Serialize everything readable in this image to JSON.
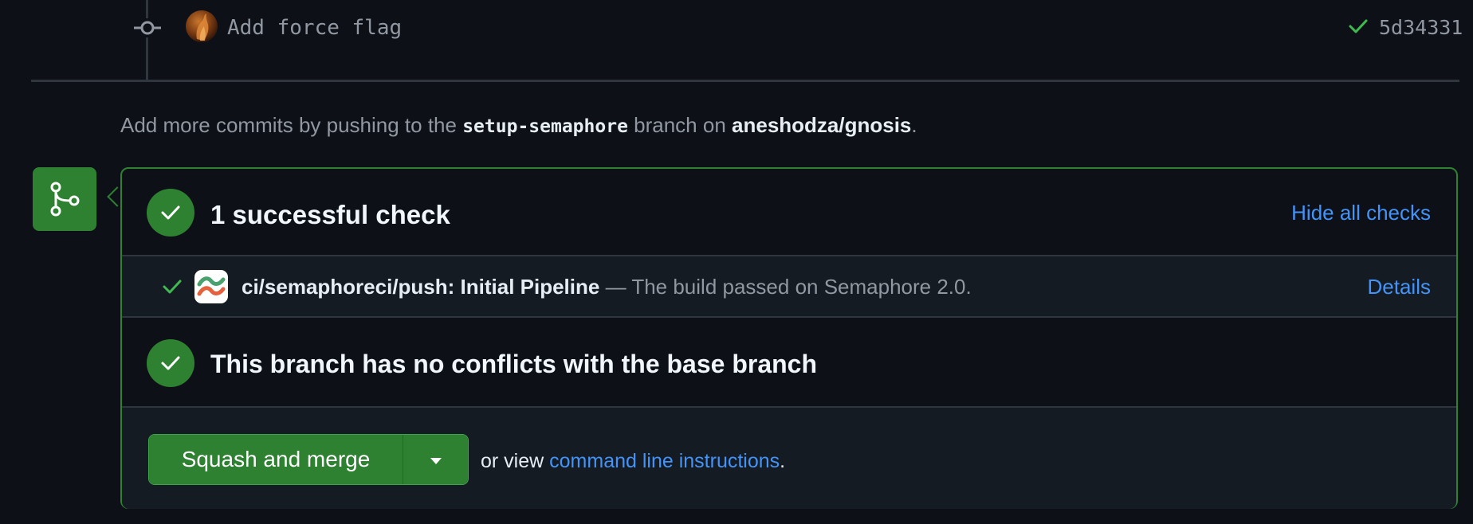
{
  "commit": {
    "message": "Add force flag",
    "sha": "5d34331",
    "status_icon": "check-icon"
  },
  "push_hint": {
    "prefix": "Add more commits by pushing to the ",
    "branch": "setup-semaphore",
    "middle": " branch on ",
    "repo": "aneshodza/gnosis",
    "suffix": "."
  },
  "checks": {
    "title": "1 successful check",
    "hide_link": "Hide all checks"
  },
  "check_row": {
    "name": "ci/semaphoreci/push: Initial Pipeline",
    "description": " — The build passed on Semaphore 2.0.",
    "details_link": "Details"
  },
  "conflicts": {
    "title": "This branch has no conflicts with the base branch"
  },
  "merge": {
    "button_label": "Squash and merge",
    "alt_prefix": "or view ",
    "alt_link": "command line instructions",
    "alt_suffix": "."
  },
  "colors": {
    "background": "#0d1117",
    "success_green": "#2f8132",
    "link_blue": "#4493f8",
    "muted_text": "#9198a1",
    "border": "#30363d"
  }
}
